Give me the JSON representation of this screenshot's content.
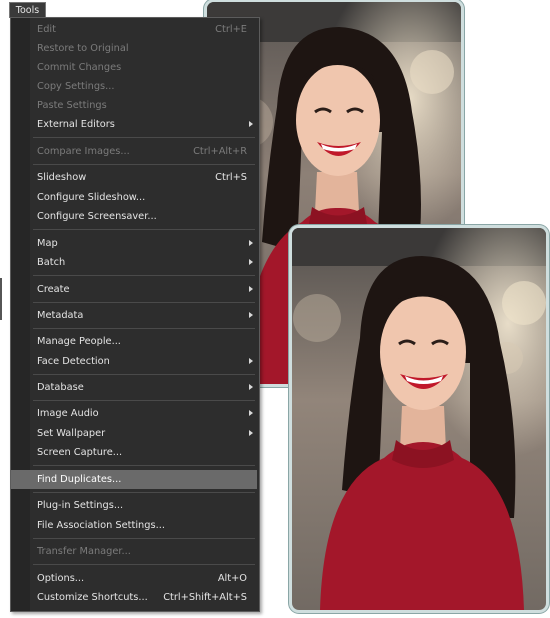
{
  "menu": {
    "title": "Tools",
    "items": [
      {
        "label": "Edit",
        "shortcut": "Ctrl+E",
        "disabled": true
      },
      {
        "label": "Restore to Original",
        "disabled": true
      },
      {
        "label": "Commit Changes",
        "disabled": true
      },
      {
        "label": "Copy Settings...",
        "disabled": true
      },
      {
        "label": "Paste Settings",
        "disabled": true
      },
      {
        "label": "External Editors",
        "submenu": true
      },
      {
        "label": "Compare Images...",
        "shortcut": "Ctrl+Alt+R",
        "disabled": true
      },
      {
        "label": "Slideshow",
        "shortcut": "Ctrl+S"
      },
      {
        "label": "Configure Slideshow..."
      },
      {
        "label": "Configure Screensaver..."
      },
      {
        "label": "Map",
        "submenu": true
      },
      {
        "label": "Batch",
        "submenu": true
      },
      {
        "label": "Create",
        "submenu": true
      },
      {
        "label": "Metadata",
        "submenu": true
      },
      {
        "label": "Manage People..."
      },
      {
        "label": "Face Detection",
        "submenu": true
      },
      {
        "label": "Database",
        "submenu": true
      },
      {
        "label": "Image Audio",
        "submenu": true
      },
      {
        "label": "Set Wallpaper",
        "submenu": true
      },
      {
        "label": "Screen Capture..."
      },
      {
        "label": "Find Duplicates...",
        "highlighted": true
      },
      {
        "label": "Plug-in Settings..."
      },
      {
        "label": "File Association Settings..."
      },
      {
        "label": "Transfer Manager...",
        "disabled": true
      },
      {
        "label": "Options...",
        "shortcut": "Alt+O"
      },
      {
        "label": "Customize Shortcuts...",
        "shortcut": "Ctrl+Shift+Alt+S"
      }
    ]
  },
  "colors": {
    "menu_background": "#2d2d2d",
    "highlight": "#6a6a6a",
    "disabled_text": "#7b7b7b",
    "photo_sweater": "#a3172a",
    "photo_frame": "#cfdede"
  }
}
